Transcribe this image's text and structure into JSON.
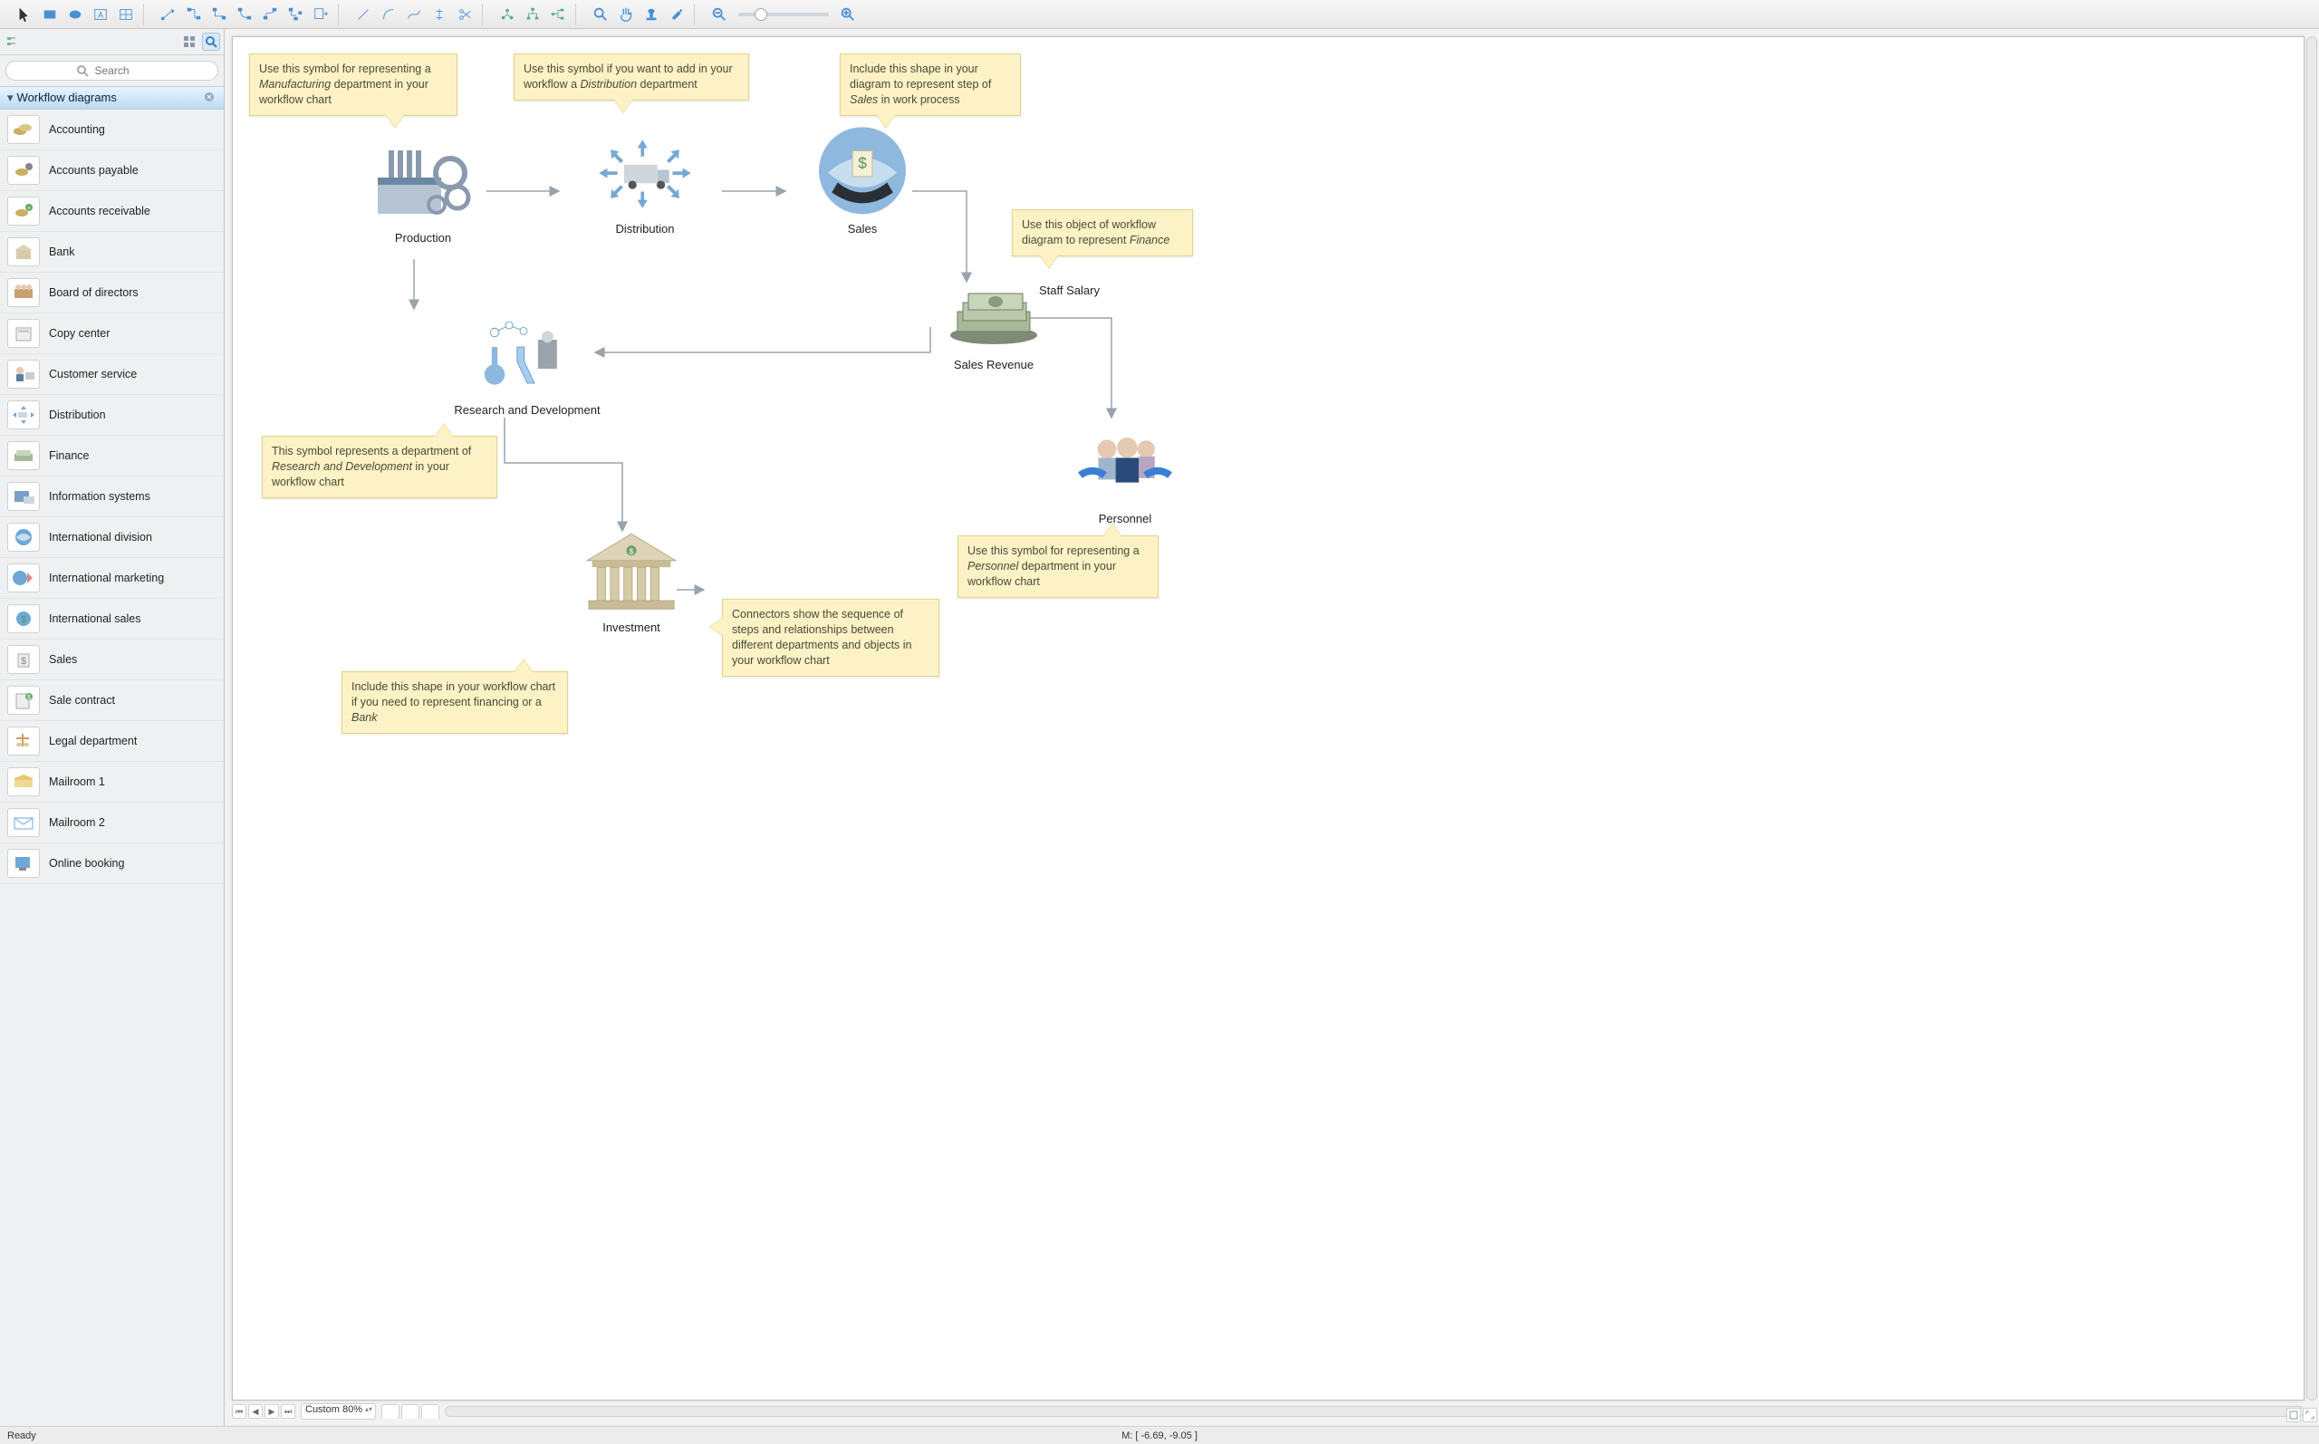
{
  "toolbar": {
    "groups": [
      {
        "name": "tools-basic",
        "buttons": [
          "pointer",
          "rect",
          "ellipse",
          "text",
          "table"
        ]
      },
      {
        "name": "tools-connectors",
        "buttons": [
          "conn-direct",
          "conn-smart",
          "conn-arc",
          "conn-round",
          "conn-bezier",
          "conn-spline",
          "conn-export"
        ]
      },
      {
        "name": "tools-lines",
        "buttons": [
          "line",
          "arc2",
          "curve",
          "split",
          "scissors"
        ]
      },
      {
        "name": "tools-tree",
        "buttons": [
          "tree1",
          "tree2",
          "tree3"
        ]
      },
      {
        "name": "tools-view",
        "buttons": [
          "zoom",
          "pan",
          "stamp",
          "eyedrop"
        ]
      }
    ],
    "zoom_out": "-",
    "zoom_in": "+"
  },
  "sidebar": {
    "search_placeholder": "Search",
    "panel_title": "Workflow diagrams",
    "items": [
      {
        "label": "Accounting"
      },
      {
        "label": "Accounts payable"
      },
      {
        "label": "Accounts receivable"
      },
      {
        "label": "Bank"
      },
      {
        "label": "Board of directors"
      },
      {
        "label": "Copy center"
      },
      {
        "label": "Customer service"
      },
      {
        "label": "Distribution"
      },
      {
        "label": "Finance"
      },
      {
        "label": "Information systems"
      },
      {
        "label": "International division"
      },
      {
        "label": "International marketing"
      },
      {
        "label": "International sales"
      },
      {
        "label": "Sales"
      },
      {
        "label": "Sale contract"
      },
      {
        "label": "Legal department"
      },
      {
        "label": "Mailroom 1"
      },
      {
        "label": "Mailroom 2"
      },
      {
        "label": "Online booking"
      }
    ]
  },
  "diagram": {
    "nodes": {
      "production": {
        "label": "Production"
      },
      "distribution": {
        "label": "Distribution"
      },
      "sales": {
        "label": "Sales"
      },
      "staff_salary": {
        "label": "Staff Salary"
      },
      "sales_revenue": {
        "label": "Sales Revenue"
      },
      "rnd": {
        "label": "Research and Development"
      },
      "personnel": {
        "label": "Personnel"
      },
      "investment": {
        "label": "Investment"
      }
    },
    "callouts": {
      "c_production": "Use this symbol for representing a <em>Manufacturing</em> department in your workflow chart",
      "c_distribution": "Use this symbol if you want to add in your workflow a <em>Distribution</em> department",
      "c_sales": "Include this shape in your diagram to represent step of <em>Sales</em> in work process",
      "c_finance": "Use this object of workflow diagram to represent <em>Finance</em>",
      "c_rnd": "This symbol represents a department of <em>Research and Development</em> in your workflow chart",
      "c_personnel": "Use this symbol for representing a <em>Personnel</em> department in your workflow chart",
      "c_connectors": "Connectors show the sequence of steps and relationships between different departments and objects in your workflow chart",
      "c_investment": "Include this shape in your workflow chart if you need to represent financing or a <em>Bank</em>"
    }
  },
  "footer": {
    "zoom_label": "Custom 80%",
    "status_left": "Ready",
    "status_coords": "M: [ -6.69, -9.05 ]"
  }
}
